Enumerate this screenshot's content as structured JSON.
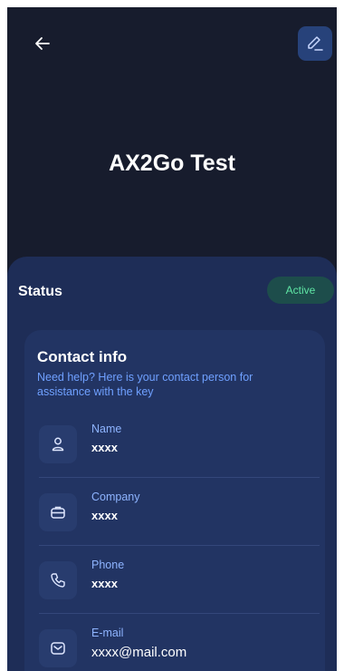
{
  "header": {
    "back_icon": "arrow-left-icon",
    "edit_icon": "pencil-icon",
    "title": "AX2Go Test"
  },
  "status": {
    "label": "Status",
    "value": "Active",
    "badge_text_color": "#5fe6a5"
  },
  "contact": {
    "title": "Contact info",
    "subtitle": "Need help? Here is your contact person for assistance with the key",
    "rows": [
      {
        "icon": "person-icon",
        "label": "Name",
        "value": "xxxx"
      },
      {
        "icon": "briefcase-icon",
        "label": "Company",
        "value": "xxxx"
      },
      {
        "icon": "phone-icon",
        "label": "Phone",
        "value": "xxxx"
      },
      {
        "icon": "mail-icon",
        "label": "E-mail",
        "value": "xxxx@mail.com"
      }
    ]
  },
  "colors": {
    "background": "#171c2d",
    "sheet": "#1e2d57",
    "card": "#223463",
    "accent": "#6fa0ff"
  }
}
